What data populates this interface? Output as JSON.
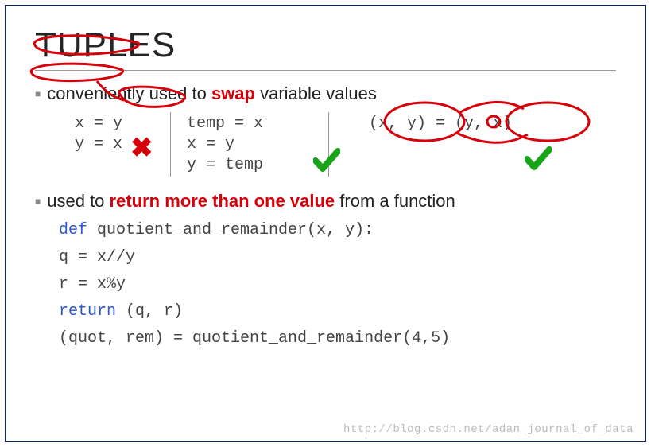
{
  "title": "TUPLES",
  "bullets": {
    "b1_pre": "conveniently used to ",
    "b1_em": "swap",
    "b1_post": " variable values",
    "b2_pre": "used to ",
    "b2_em": "return more than one value",
    "b2_post": " from a function"
  },
  "swap": {
    "col1": [
      "x = y",
      "y = x"
    ],
    "col2": [
      "temp = x",
      "x = y",
      "y = temp"
    ],
    "col3": "(x, y) = (y, x)"
  },
  "func": {
    "l1_def": "def",
    "l1_rest": " quotient_and_remainder(x, y):",
    "l2": "q = x//y",
    "l3": "r = x%y",
    "l4_ret": "return",
    "l4_rest": " (q, r)",
    "l5": "(quot, rem) = quotient_and_remainder(4,5)"
  },
  "watermark": "http://blog.csdn.net/adan_journal_of_data"
}
